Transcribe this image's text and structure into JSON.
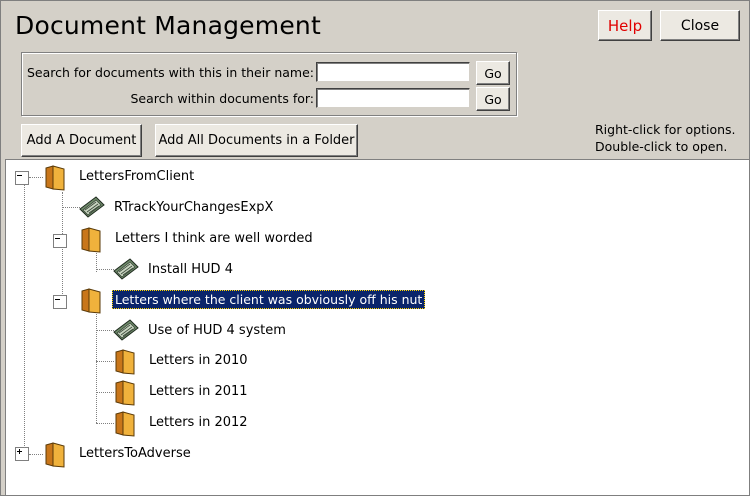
{
  "window": {
    "title": "Document Management"
  },
  "header": {
    "help_label": "Help",
    "close_label": "Close"
  },
  "search": {
    "name_label": "Search for documents with this in their name:",
    "content_label": "Search within documents for:",
    "name_value": "",
    "content_value": "",
    "go_label": "Go"
  },
  "toolbar": {
    "add_document_label": "Add A Document",
    "add_folder_label": "Add All Documents in a Folder",
    "hint_line1": "Right-click for options.",
    "hint_line2": "Double-click to open."
  },
  "tree": {
    "items": [
      {
        "label": "LettersFromClient",
        "type": "folder",
        "expanded": true,
        "level": 0
      },
      {
        "label": "RTrackYourChangesExpX",
        "type": "document",
        "level": 1
      },
      {
        "label": "Letters I think are well worded",
        "type": "folder",
        "expanded": true,
        "level": 1
      },
      {
        "label": "Install HUD 4",
        "type": "document",
        "level": 2
      },
      {
        "label": "Letters where the client was obviously off his nut",
        "type": "folder",
        "expanded": true,
        "level": 1,
        "selected": true
      },
      {
        "label": "Use of HUD 4 system",
        "type": "document",
        "level": 2
      },
      {
        "label": "Letters in 2010",
        "type": "folder",
        "level": 2
      },
      {
        "label": "Letters in 2011",
        "type": "folder",
        "level": 2
      },
      {
        "label": "Letters in 2012",
        "type": "folder",
        "level": 2
      },
      {
        "label": "LettersToAdverse",
        "type": "folder",
        "expanded": false,
        "level": 0
      }
    ]
  },
  "colors": {
    "selection": "#0a246a",
    "help_text": "#e00000",
    "folder": "#e8a42c"
  }
}
